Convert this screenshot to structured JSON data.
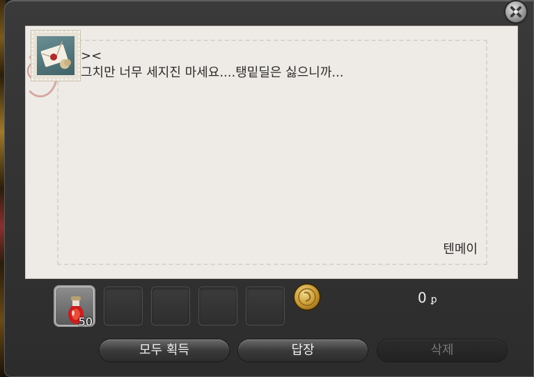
{
  "window": {
    "close_icon": "close-icon",
    "accent_color": "#eeebe6"
  },
  "letter": {
    "stamp_icon": "stamp-icon",
    "body": "><\n그치만 너무 세지진 마세요....탱밑딜은 싫으니까...",
    "sender": "텐메이"
  },
  "attachments": {
    "item": {
      "icon": "potion-icon",
      "quantity": "50"
    },
    "empty_slots": 4,
    "gil_icon": "gil-coin-icon",
    "gil_amount": "0",
    "gil_unit": "ꝑ"
  },
  "buttons": {
    "take_all": "모두 획득",
    "reply": "답장",
    "delete": "삭제"
  }
}
